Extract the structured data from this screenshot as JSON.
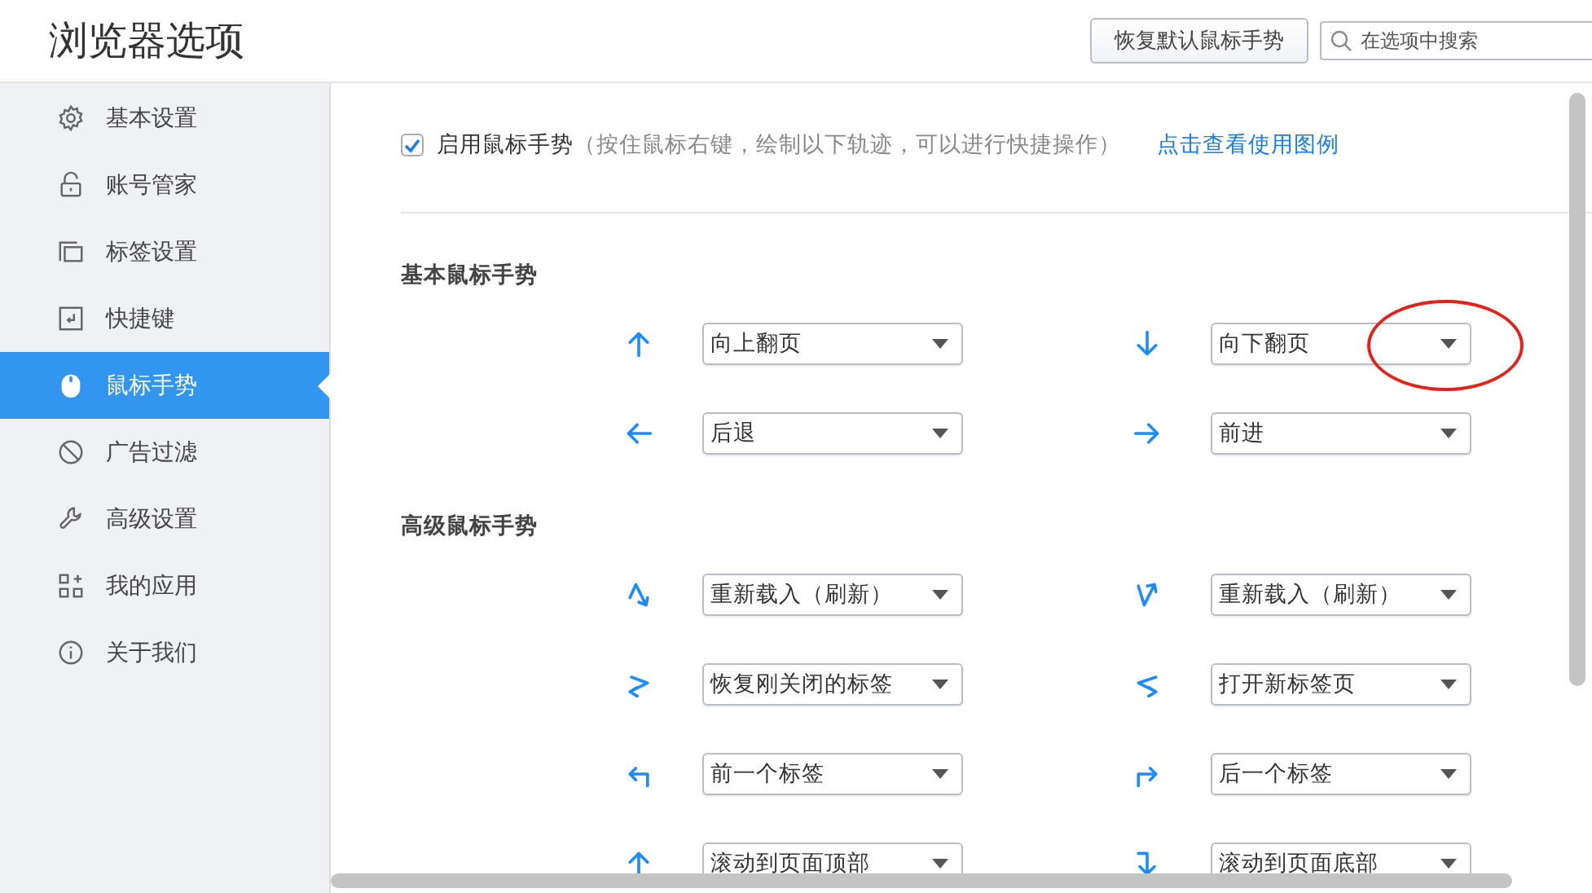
{
  "window": {
    "title": "浏览器选项"
  },
  "header": {
    "restore_button": "恢复默认鼠标手势",
    "search": {
      "placeholder": "在选项中搜索"
    }
  },
  "sidebar": {
    "items": [
      {
        "label": "基本设置",
        "kind": "gear",
        "selected": false
      },
      {
        "label": "账号管家",
        "kind": "lock",
        "selected": false
      },
      {
        "label": "标签设置",
        "kind": "tabs",
        "selected": false
      },
      {
        "label": "快捷键",
        "kind": "shortcut",
        "selected": false
      },
      {
        "label": "鼠标手势",
        "kind": "mouse",
        "selected": true
      },
      {
        "label": "广告过滤",
        "kind": "block",
        "selected": false
      },
      {
        "label": "高级设置",
        "kind": "wrench",
        "selected": false
      },
      {
        "label": "我的应用",
        "kind": "apps",
        "selected": false
      },
      {
        "label": "关于我们",
        "kind": "info",
        "selected": false
      }
    ]
  },
  "enable": {
    "checked": true,
    "label": "启用鼠标手势",
    "hint": "（按住鼠标右键，绘制以下轨迹，可以进行快捷操作）",
    "link": "点击查看使用图例"
  },
  "sections": [
    {
      "title": "基本鼠标手势",
      "gestures": [
        {
          "kind": "up",
          "action": "向上翻页",
          "circled": false
        },
        {
          "kind": "down",
          "action": "向下翻页",
          "circled": true
        },
        {
          "kind": "left",
          "action": "后退",
          "circled": false
        },
        {
          "kind": "right",
          "action": "前进",
          "circled": false
        }
      ]
    },
    {
      "title": "高级鼠标手势",
      "gestures": [
        {
          "kind": "up-down",
          "action": "重新载入（刷新）",
          "circled": false
        },
        {
          "kind": "down-up",
          "action": "重新载入（刷新）",
          "circled": false
        },
        {
          "kind": "right-left",
          "action": "恢复刚关闭的标签",
          "circled": false
        },
        {
          "kind": "left-right",
          "action": "打开新标签页",
          "circled": false
        },
        {
          "kind": "turn-left",
          "action": "前一个标签",
          "circled": false
        },
        {
          "kind": "turn-right",
          "action": "后一个标签",
          "circled": false
        },
        {
          "kind": "up",
          "action": "滚动到页面顶部",
          "circled": false
        },
        {
          "kind": "hook-down",
          "action": "滚动到页面底部",
          "circled": false
        }
      ]
    }
  ]
}
